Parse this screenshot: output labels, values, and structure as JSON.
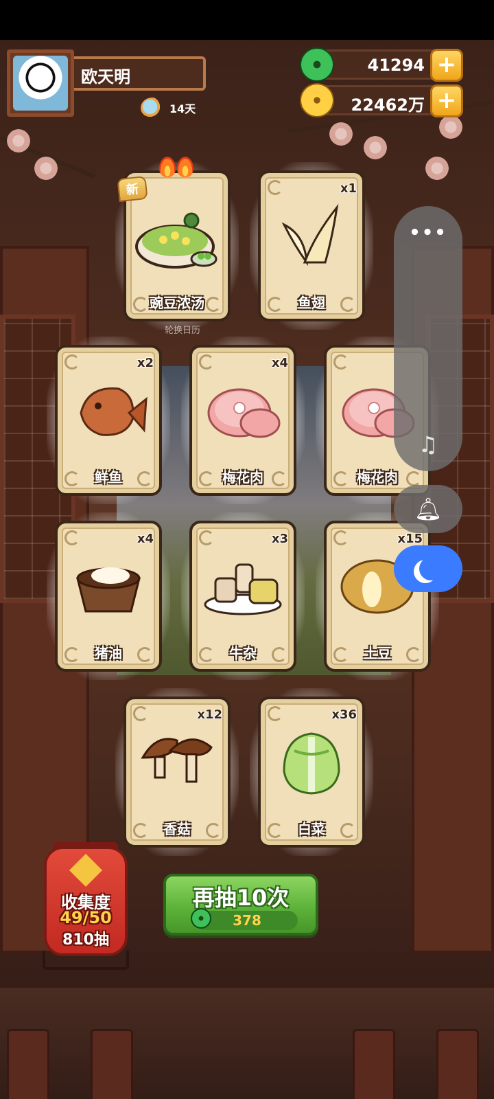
{
  "player": {
    "name": "欧天明",
    "days": "14天"
  },
  "currency": {
    "jade": "41294",
    "gold": "22462万",
    "plus": "+"
  },
  "cards": [
    {
      "name": "豌豆浓汤",
      "count": "",
      "art": "pea-soup",
      "is_new": true,
      "new_label": "新"
    },
    {
      "name": "鱼翅",
      "count": "x1",
      "art": "shark-fin"
    },
    {
      "name": "鲜鱼",
      "count": "x2",
      "art": "fish"
    },
    {
      "name": "梅花肉",
      "count": "x4",
      "art": "pork"
    },
    {
      "name": "梅花肉",
      "count": "",
      "art": "pork"
    },
    {
      "name": "猪油",
      "count": "x4",
      "art": "lard"
    },
    {
      "name": "牛杂",
      "count": "x3",
      "art": "beef-offal"
    },
    {
      "name": "土豆",
      "count": "x15",
      "art": "potato"
    },
    {
      "name": "香菇",
      "count": "x12",
      "art": "mushroom"
    },
    {
      "name": "白菜",
      "count": "x36",
      "art": "cabbage"
    }
  ],
  "calendar_label": "轮换日历",
  "side_menu": {
    "more": "•••",
    "music_icon": "music-off-icon",
    "bell_icon": "bell-icon",
    "moon_icon": "moon-icon"
  },
  "collection": {
    "title": "收集度",
    "progress": "49/50",
    "draws": "810抽"
  },
  "draw_button": {
    "label": "再抽10次",
    "cost": "378"
  }
}
